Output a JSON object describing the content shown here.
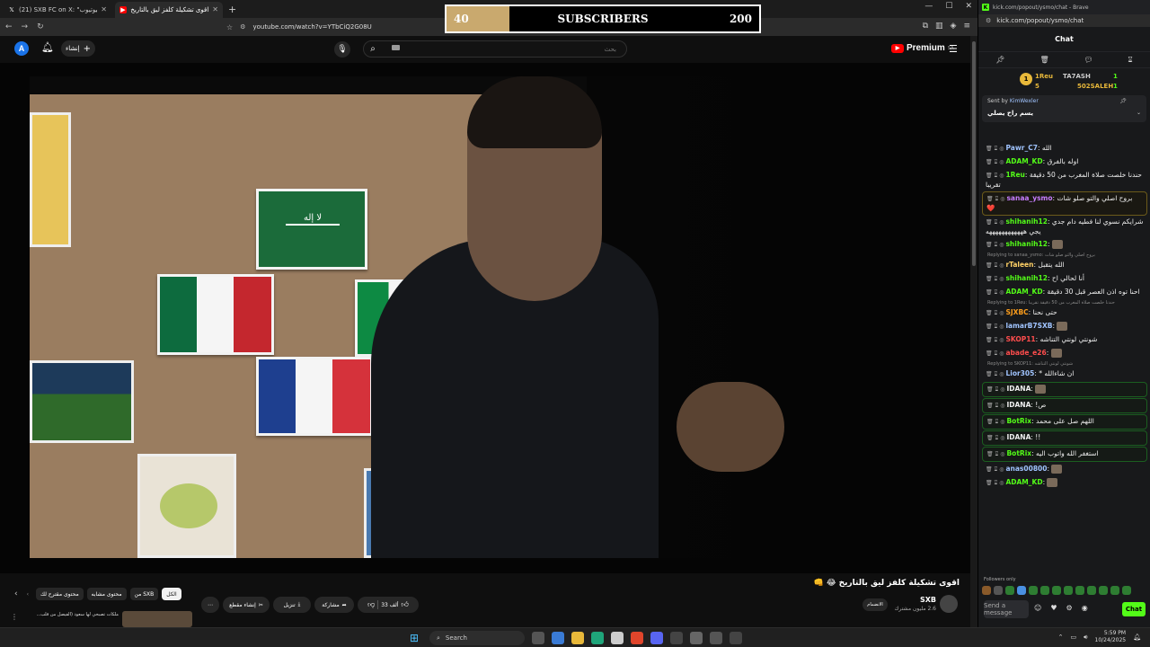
{
  "browser": {
    "tabs": [
      {
        "title": "(21) SXB FC on X: \"الآن على اليوتيوب",
        "icon": "x-logo-icon",
        "active": false
      },
      {
        "title": "اقوى تشكيلة كلفز ليق بالتاريخ 🔊",
        "icon": "youtube-icon",
        "active": true
      }
    ],
    "url": "youtube.com/watch?v=YTbCiQ2G08U"
  },
  "youtube": {
    "avatar_letter": "A",
    "create_label": "إنشاء",
    "search_placeholder": "بحث",
    "logo_text": "Premium",
    "logo_sup": "SA",
    "video_title": "اقوى تشكيلة كلفز ليق بالتاريخ 😂 👊",
    "channel_name": "SXB",
    "channel_subs": "2.6 مليون مشترك",
    "join_label": "الانضمام",
    "actions": {
      "like_count": "33 ألف",
      "share_label": "مشاركة",
      "download_label": "تنزيل",
      "clip_label": "إنشاء مقطع"
    },
    "chips": [
      "الكل",
      "من SXB",
      "محتوى مشابه",
      "محتوى مقترح لك"
    ],
    "rec_title": "ملكات تصبحي لها سعود (الفيصل من قلب..."
  },
  "subscriber_goal": {
    "current": "40",
    "label": "SUBSCRIBERS",
    "goal": "200",
    "progress_fraction": 0.2
  },
  "kick": {
    "window_title": "kick.com/popout/ysmo/chat - Brave",
    "url": "kick.com/popout/ysmo/chat",
    "header": "Chat",
    "leaderboard": [
      {
        "rank": "1",
        "name": "1Reu",
        "count": "1"
      },
      {
        "rank": "5",
        "name": "TA7ASH",
        "count": "1"
      },
      {
        "rank": "",
        "name": "502SALEH",
        "count": "1"
      }
    ],
    "pinned": {
      "sent_by": "Sent by",
      "sender": "KimWexler",
      "message": "يسم راح يصلي"
    },
    "messages": [
      {
        "user": "Pawr_C7",
        "color": "#a0c4ff",
        "text": "الله"
      },
      {
        "user": "ADAM_KD",
        "color": "#53fc18",
        "text": "اوله بالفرق"
      },
      {
        "user": "1Reu",
        "color": "#53fc18",
        "text": "حندنا خلصت صلاة المغرب من 50 دقيقة تقريبا"
      },
      {
        "user": "sanaa_ysmo",
        "color": "#c77dff",
        "text": "بروح اصلي والتو صلو شات ❤️"
      },
      {
        "user": "shihanih12",
        "color": "#53fc18",
        "text": "شرايكم نسوي لنا فطيه دام جدي يجي ههههههههههههه"
      },
      {
        "user": "shihanih12",
        "color": "#53fc18",
        "text": ""
      },
      {
        "reply": "Replying to sanaa_ysmo: بروح اصلي والتو صلو شات"
      },
      {
        "user": "rTaleen",
        "color": "#ffd166",
        "text": "الله يتقبل"
      },
      {
        "user": "shihanih12",
        "color": "#53fc18",
        "text": "أنا لحالي اح"
      },
      {
        "user": "ADAM_KD",
        "color": "#53fc18",
        "text": "احنا توه اذن العصر قبل 30 دقيقة"
      },
      {
        "reply": "Replying to 1Reu: حندنا خلصت صلاة المغرب من 50 دقيقة تقريبا"
      },
      {
        "user": "SJXBC",
        "color": "#ff9f1c",
        "text": "حتى نحنا"
      },
      {
        "user": "lamarB7SXB",
        "color": "#a0c4ff",
        "text": ""
      },
      {
        "user": "SKOP11",
        "color": "#ff4d4d",
        "text": "شونتي لونتي التناشه"
      },
      {
        "user": "abade_e26",
        "color": "#ff4d4d",
        "text": ""
      },
      {
        "reply": "Replying to SKOP11: شونتي لونتي التناشه"
      },
      {
        "user": "Lior305",
        "color": "#a0c4ff",
        "text": "ان شاءالله *"
      },
      {
        "user": "IDANA",
        "color": "#eeeeee",
        "text": ""
      },
      {
        "user": "IDANA",
        "color": "#eeeeee",
        "text": "ص!"
      },
      {
        "user": "BotRix",
        "color": "#53fc18",
        "text": "اللهم صل على محمد"
      },
      {
        "user": "IDANA",
        "color": "#eeeeee",
        "text": "!!"
      },
      {
        "user": "BotRix",
        "color": "#53fc18",
        "text": "استغفر الله واتوب اليه"
      },
      {
        "user": "anas00800",
        "color": "#a0c4ff",
        "text": ""
      },
      {
        "user": "ADAM_KD",
        "color": "#53fc18",
        "text": ""
      }
    ],
    "followers_only": "Followers only",
    "input_placeholder": "Send a message",
    "send_label": "Chat"
  },
  "taskbar": {
    "search_label": "Search",
    "time": "5:59 PM",
    "date": "10/24/2025"
  }
}
